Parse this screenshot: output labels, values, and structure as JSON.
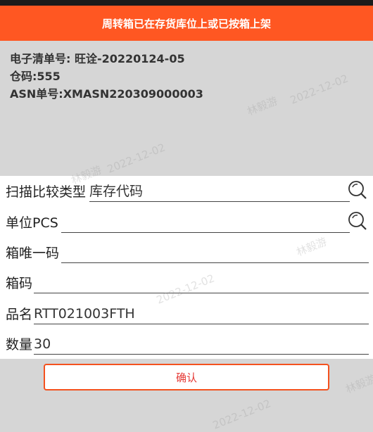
{
  "banner": {
    "message": "周转箱已在存货库位上或已按箱上架"
  },
  "info": {
    "doc_no": "电子清单号: 旺诠-20220124-05",
    "warehouse": "仓码:555",
    "asn": "ASN单号:XMASN220309000003"
  },
  "form": {
    "scan_compare": {
      "label": "扫描比较类型",
      "value": "库存代码"
    },
    "unit": {
      "label": "单位",
      "value": "PCS"
    },
    "box_unique": {
      "label": "箱唯一码",
      "value": ""
    },
    "box_code": {
      "label": "箱码",
      "value": ""
    },
    "product_name": {
      "label": "品名",
      "value": "RTT021003FTH"
    },
    "quantity": {
      "label": "数量",
      "value": "30"
    }
  },
  "actions": {
    "confirm_label": "确认"
  },
  "watermark": {
    "name": "林毅游",
    "date": "2022-12-02"
  },
  "colors": {
    "banner": "#ff5722",
    "confirm_border": "#f4511e",
    "confirm_text": "#e53935"
  }
}
